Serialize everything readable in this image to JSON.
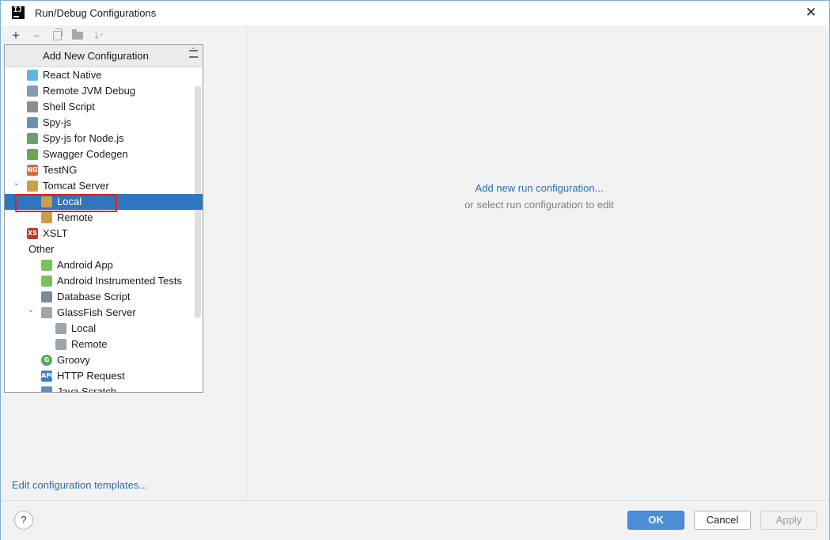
{
  "window": {
    "title": "Run/Debug Configurations",
    "app_icon_text": "IJ"
  },
  "toolbar": {
    "add_icon": "plus-icon",
    "remove_icon": "minus-icon",
    "copy_icon": "copy-icon",
    "folder_icon": "new-folder-icon",
    "sort_icon": "sort-icon",
    "sort_glyph": "↓ᶻ"
  },
  "popup": {
    "title": "Add New Configuration",
    "items": [
      {
        "label": "React Native",
        "icon": "react-native-icon",
        "level": 1
      },
      {
        "label": "Remote JVM Debug",
        "icon": "remote-debug-icon",
        "level": 1
      },
      {
        "label": "Shell Script",
        "icon": "shell-script-icon",
        "level": 1
      },
      {
        "label": "Spy-js",
        "icon": "spy-js-icon",
        "level": 1
      },
      {
        "label": "Spy-js for Node.js",
        "icon": "spy-js-node-icon",
        "level": 1
      },
      {
        "label": "Swagger Codegen",
        "icon": "swagger-icon",
        "level": 1
      },
      {
        "label": "TestNG",
        "icon": "testng-icon",
        "level": 1,
        "icon_text": "NG"
      },
      {
        "label": "Tomcat Server",
        "icon": "tomcat-icon",
        "level": 1,
        "expanded": true
      },
      {
        "label": "Local",
        "icon": "tomcat-icon",
        "level": 2,
        "selected": true
      },
      {
        "label": "Remote",
        "icon": "tomcat-icon",
        "level": 2
      },
      {
        "label": "XSLT",
        "icon": "xslt-icon",
        "level": 1,
        "icon_text": "XS"
      },
      {
        "label": "Other",
        "icon": "",
        "level": 0,
        "expanded": true
      },
      {
        "label": "Android App",
        "icon": "android-icon",
        "level": 2
      },
      {
        "label": "Android Instrumented Tests",
        "icon": "android-test-icon",
        "level": 2
      },
      {
        "label": "Database Script",
        "icon": "database-icon",
        "level": 2
      },
      {
        "label": "GlassFish Server",
        "icon": "glassfish-icon",
        "level": 2,
        "expanded": true
      },
      {
        "label": "Local",
        "icon": "glassfish-icon",
        "level": 3
      },
      {
        "label": "Remote",
        "icon": "glassfish-icon",
        "level": 3
      },
      {
        "label": "Groovy",
        "icon": "groovy-icon",
        "level": 2,
        "icon_text": "G"
      },
      {
        "label": "HTTP Request",
        "icon": "http-request-icon",
        "level": 2,
        "icon_text": "API"
      },
      {
        "label": "Java Scratch",
        "icon": "java-scratch-icon",
        "level": 2
      }
    ]
  },
  "left_footer": {
    "edit_templates": "Edit configuration templates..."
  },
  "right": {
    "add_link": "Add new run configuration...",
    "hint": "or select run configuration to edit"
  },
  "buttons": {
    "help": "?",
    "ok": "OK",
    "cancel": "Cancel",
    "apply": "Apply"
  },
  "colors": {
    "selection": "#2f75c0",
    "link": "#2a6fb5",
    "highlight_box": "#e02020",
    "ok_button": "#4a8fd7"
  }
}
